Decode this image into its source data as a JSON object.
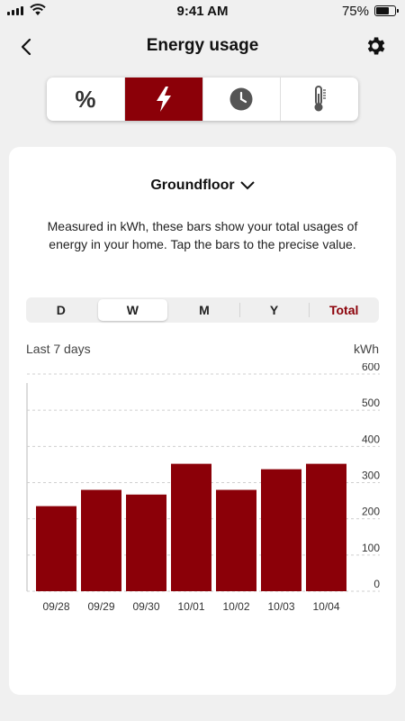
{
  "status_bar": {
    "time": "9:41 AM",
    "battery_percent": "75%",
    "battery_level": 0.75
  },
  "header": {
    "title": "Energy usage"
  },
  "modes": [
    {
      "name": "percent",
      "label": "%",
      "active": false
    },
    {
      "name": "energy",
      "icon": "lightning-icon",
      "active": true
    },
    {
      "name": "time",
      "icon": "clock-icon",
      "active": false
    },
    {
      "name": "temperature",
      "icon": "thermometer-icon",
      "active": false
    }
  ],
  "card": {
    "floor": "Groundfloor",
    "description": "Measured in kWh, these bars show your total usages of energy in your home. Tap the bars to the precise value.",
    "ranges": [
      "D",
      "W",
      "M",
      "Y",
      "Total"
    ],
    "selected_range": "W",
    "period_label": "Last 7 days",
    "unit_label": "kWh"
  },
  "colors": {
    "accent": "#8b0008",
    "bar": "#8b0008",
    "background": "#f0f0f0"
  },
  "chart_data": {
    "type": "bar",
    "categories": [
      "09/28",
      "09/29",
      "09/30",
      "10/01",
      "10/02",
      "10/03",
      "10/04"
    ],
    "values": [
      235,
      280,
      267,
      352,
      280,
      337,
      352
    ],
    "ylabel": "kWh",
    "ylim": [
      0,
      600
    ],
    "yticks": [
      0,
      100,
      200,
      300,
      400,
      500,
      600
    ],
    "grid": true
  }
}
